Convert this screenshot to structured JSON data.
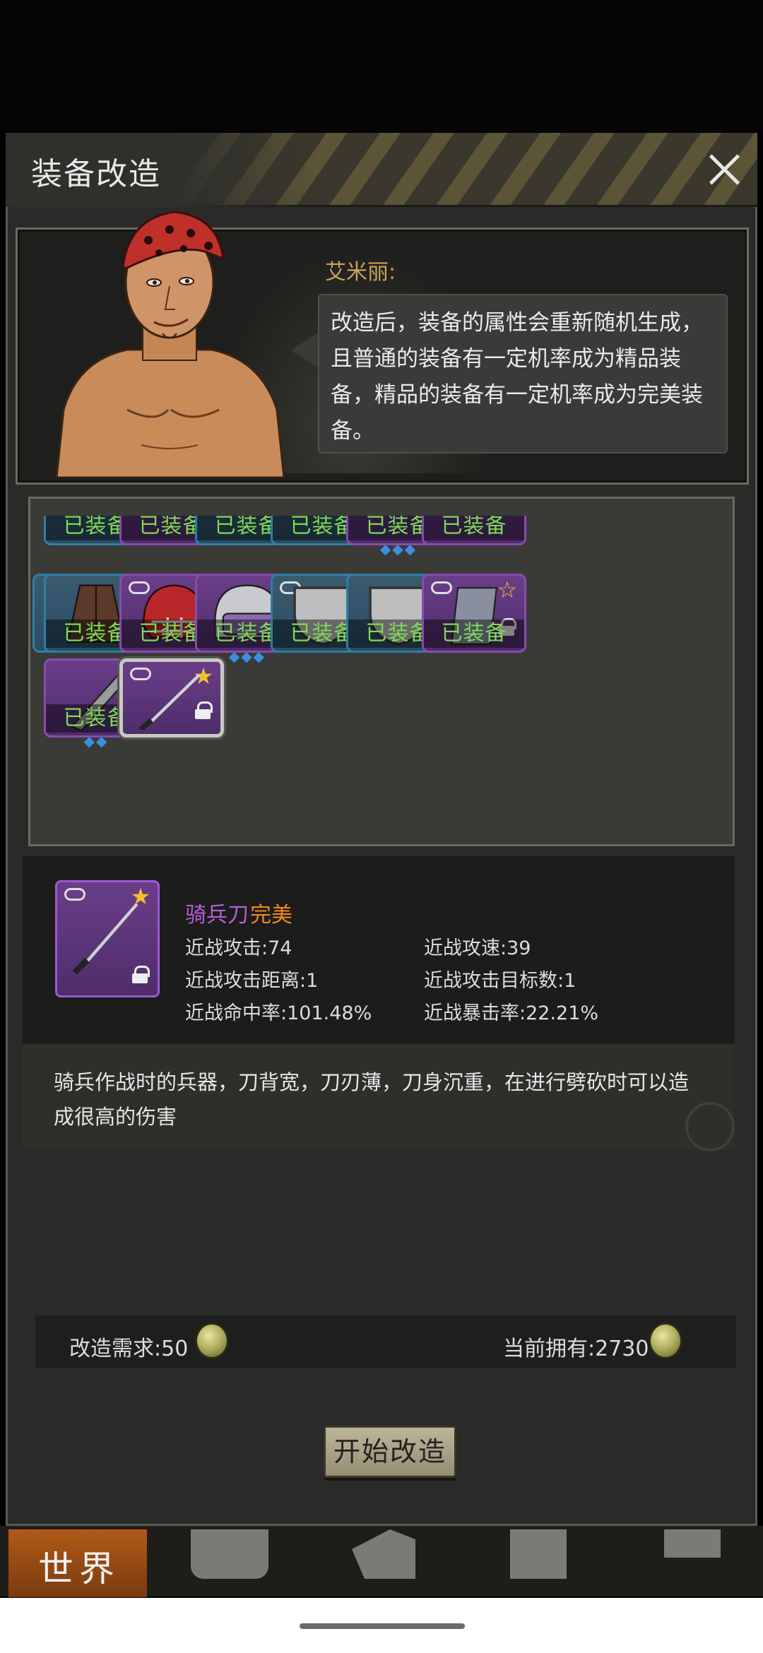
{
  "dialog": {
    "title": "装备改造",
    "close_icon": "close-icon"
  },
  "npc": {
    "name": "艾米丽:",
    "speech": "改造后，装备的属性会重新随机生成，且普通的装备有一定机率成为精品装备，精品的装备有一定机率成为完美装备。"
  },
  "inventory": {
    "equipped_label": "已装备",
    "rows": [
      [
        "blue",
        "purple",
        "blue",
        "blue",
        "purple",
        "purple"
      ],
      [
        "blue",
        "purple",
        "purple",
        "blue",
        "blue",
        "purple"
      ],
      [
        "purple",
        "purple"
      ]
    ]
  },
  "selected_item": {
    "name": "骑兵刀",
    "quality": "完美",
    "stats": [
      {
        "label": "近战攻击:74"
      },
      {
        "label": "近战攻速:39"
      },
      {
        "label": "近战攻击距离:1"
      },
      {
        "label": "近战攻击目标数:1"
      },
      {
        "label": "近战命中率:101.48%"
      },
      {
        "label": "近战暴击率:22.21%"
      }
    ],
    "description": "骑兵作战时的兵器，刀背宽，刀刃薄，刀身沉重，在进行劈砍时可以造成很高的伤害"
  },
  "cost": {
    "required": "改造需求:50",
    "owned": "当前拥有:2730"
  },
  "start_button": "开始改造",
  "nav": {
    "world": "世界"
  },
  "colors": {
    "purple_quality": "#b45ed6",
    "perfect_quality": "#f08a1c",
    "equipped_green": "#7ed957",
    "npc_name": "#c9a45a"
  }
}
